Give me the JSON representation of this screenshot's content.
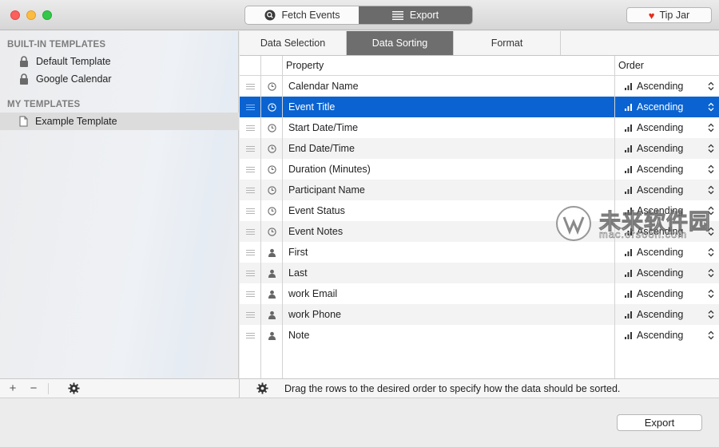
{
  "window": {
    "segments": [
      {
        "label": "Fetch Events",
        "icon": "search-icon",
        "active": false
      },
      {
        "label": "Export",
        "icon": "list-icon",
        "active": true
      }
    ],
    "tip_jar_label": "Tip Jar"
  },
  "sidebar": {
    "builtin_heading": "BUILT-IN TEMPLATES",
    "builtin_items": [
      {
        "label": "Default Template",
        "icon": "lock-icon"
      },
      {
        "label": "Google Calendar",
        "icon": "lock-icon"
      }
    ],
    "my_heading": "MY TEMPLATES",
    "my_items": [
      {
        "label": "Example Template",
        "icon": "document-icon",
        "selected": true
      }
    ],
    "footer": {
      "add": "+",
      "remove": "−"
    }
  },
  "tabs": [
    {
      "label": "Data Selection",
      "active": false
    },
    {
      "label": "Data Sorting",
      "active": true
    },
    {
      "label": "Format",
      "active": false
    }
  ],
  "table": {
    "headers": {
      "property": "Property",
      "order": "Order"
    },
    "rows": [
      {
        "property": "Calendar Name",
        "type": "clock-icon",
        "order": "Ascending",
        "selected": false
      },
      {
        "property": "Event Title",
        "type": "clock-icon",
        "order": "Ascending",
        "selected": true
      },
      {
        "property": "Start Date/Time",
        "type": "clock-icon",
        "order": "Ascending",
        "selected": false
      },
      {
        "property": "End Date/Time",
        "type": "clock-icon",
        "order": "Ascending",
        "selected": false
      },
      {
        "property": "Duration (Minutes)",
        "type": "clock-icon",
        "order": "Ascending",
        "selected": false
      },
      {
        "property": "Participant Name",
        "type": "clock-icon",
        "order": "Ascending",
        "selected": false
      },
      {
        "property": "Event Status",
        "type": "clock-icon",
        "order": "Ascending",
        "selected": false
      },
      {
        "property": "Event Notes",
        "type": "clock-icon",
        "order": "Ascending",
        "selected": false
      },
      {
        "property": "First",
        "type": "person-icon",
        "order": "Ascending",
        "selected": false
      },
      {
        "property": "Last",
        "type": "person-icon",
        "order": "Ascending",
        "selected": false
      },
      {
        "property": "work Email",
        "type": "person-icon",
        "order": "Ascending",
        "selected": false
      },
      {
        "property": "work Phone",
        "type": "person-icon",
        "order": "Ascending",
        "selected": false
      },
      {
        "property": "Note",
        "type": "person-icon",
        "order": "Ascending",
        "selected": false
      }
    ]
  },
  "status": {
    "hint": "Drag the rows to the desired order to specify how the data should be sorted."
  },
  "export_button_label": "Export",
  "watermark": {
    "main": "未来软件园",
    "sub": "mac.orsoon.com"
  },
  "colors": {
    "selection": "#0a63d1",
    "active_segment": "#6b6b6b",
    "heart": "#e0301e"
  }
}
